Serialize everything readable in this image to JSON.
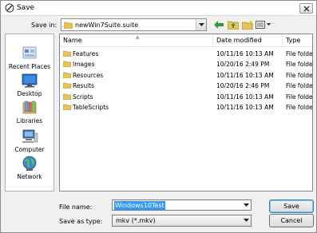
{
  "window": {
    "title": "Save"
  },
  "location": {
    "label": "Save in:",
    "value": "newWin7Suite.suite"
  },
  "places": [
    {
      "label": "Recent Places",
      "icon": "recent-places-icon"
    },
    {
      "label": "Desktop",
      "icon": "desktop-icon"
    },
    {
      "label": "Libraries",
      "icon": "libraries-icon"
    },
    {
      "label": "Computer",
      "icon": "computer-icon"
    },
    {
      "label": "Network",
      "icon": "network-icon"
    }
  ],
  "columns": {
    "name": "Name",
    "date": "Date modified",
    "type": "Type"
  },
  "files": [
    {
      "name": "Features",
      "date": "10/11/16 10:13 AM",
      "type": "File folder"
    },
    {
      "name": "Images",
      "date": "10/20/16 2:49 PM",
      "type": "File folder"
    },
    {
      "name": "Resources",
      "date": "10/11/16 10:13 AM",
      "type": "File folder"
    },
    {
      "name": "Results",
      "date": "10/20/16 2:46 PM",
      "type": "File folder"
    },
    {
      "name": "Scripts",
      "date": "10/11/16 10:13 AM",
      "type": "File folder"
    },
    {
      "name": "TableScripts",
      "date": "10/11/16 10:13 AM",
      "type": "File folder"
    }
  ],
  "filename": {
    "label": "File name:",
    "value": "Windows10Test"
  },
  "savetype": {
    "label": "Save as type:",
    "value": "mkv (*.mkv)"
  },
  "buttons": {
    "save": "Save",
    "cancel": "Cancel"
  },
  "colors": {
    "selection": "#3399ff",
    "folder": "#e8c35a"
  }
}
